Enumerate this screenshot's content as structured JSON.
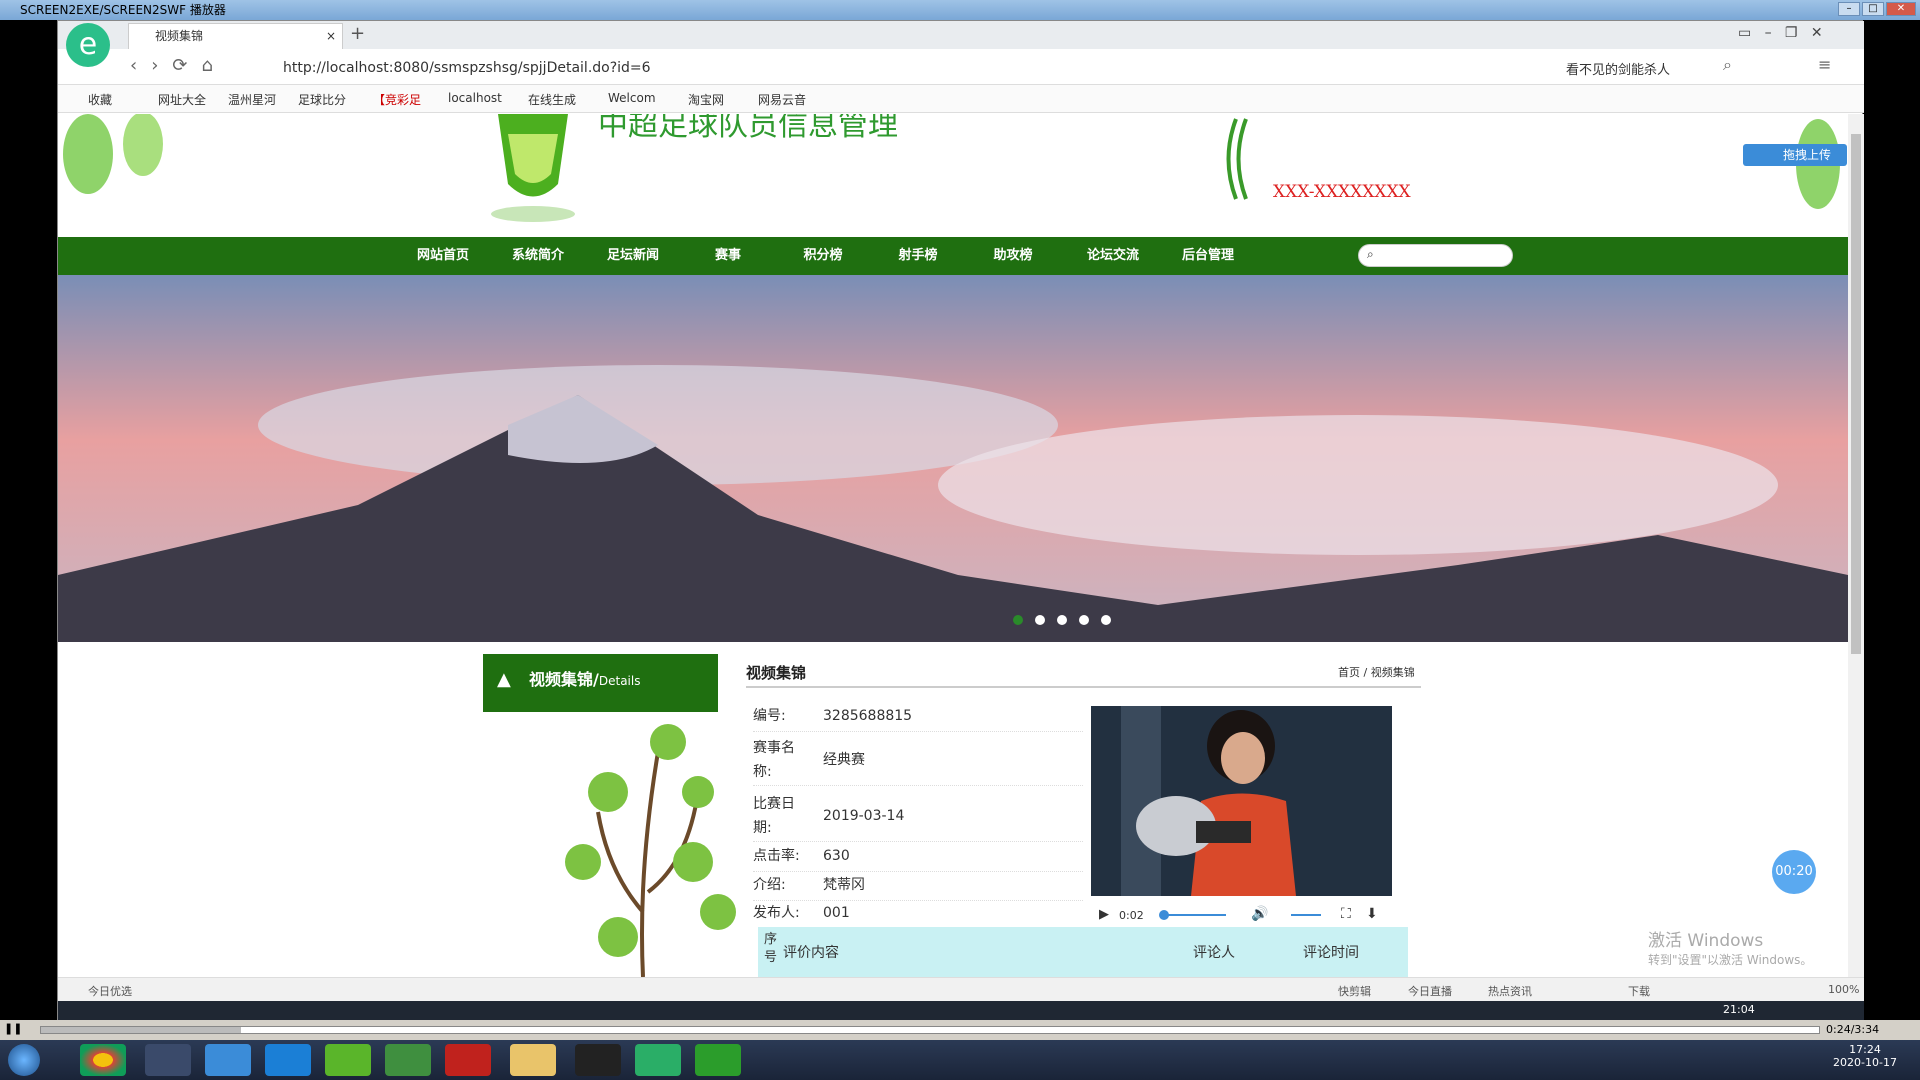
{
  "player": {
    "title": "SCREEN2EXE/SCREEN2SWF 播放器",
    "time": "0:24/3:34"
  },
  "browser": {
    "tab_title": "视频集锦",
    "url": "http://localhost:8080/ssmspzshsg/spjjDetail.do?id=6",
    "search_hint": "看不见的剑能杀人",
    "bookmarks": [
      "收藏",
      "网址大全",
      "温州星河",
      "足球比分",
      "【竞彩足",
      "localhost",
      "在线生成",
      "Welcom",
      "淘宝网",
      "网易云音"
    ],
    "status_left": "今日优选",
    "status_items": [
      "快剪辑",
      "今日直播",
      "热点资讯",
      "下载",
      "100%"
    ],
    "inner_clock": "21:04"
  },
  "header": {
    "site_title": "中超足球队员信息管理",
    "contact": "XXX-XXXXXXXX",
    "upload_btn": "拖拽上传"
  },
  "nav": {
    "items": [
      "网站首页",
      "系统简介",
      "足坛新闻",
      "赛事",
      "积分榜",
      "射手榜",
      "助攻榜",
      "论坛交流",
      "后台管理"
    ]
  },
  "sidebar": {
    "heading": "视频集锦/",
    "heading_suffix": "Details"
  },
  "main": {
    "title": "视频集锦",
    "crumb_home": "首页",
    "crumb_sep": " / ",
    "crumb_current": "视频集锦",
    "fields": [
      {
        "k": "编号:",
        "v": "3285688815"
      },
      {
        "k": "赛事名称:",
        "v": "经典赛"
      },
      {
        "k": "比赛日期:",
        "v": "2019-03-14"
      },
      {
        "k": "点击率:",
        "v": "630"
      },
      {
        "k": "介绍:",
        "v": "梵蒂冈"
      },
      {
        "k": "发布人:",
        "v": "001"
      }
    ],
    "video_time": "0:02",
    "comment_headers": {
      "no": "序号",
      "content": "评价内容",
      "user": "评论人",
      "time": "评论时间"
    }
  },
  "overlay": {
    "timer": "00:20",
    "watermark_title": "激活 Windows",
    "watermark_sub": "转到\"设置\"以激活 Windows。"
  },
  "taskbar": {
    "clock_time": "17:24",
    "clock_date": "2020-10-17"
  }
}
